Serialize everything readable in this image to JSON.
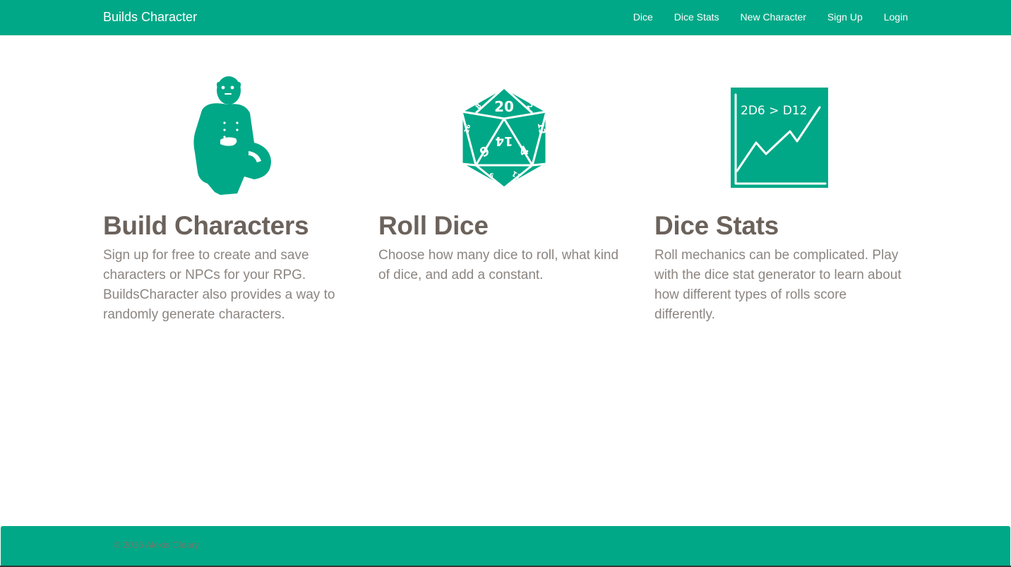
{
  "navbar": {
    "brand": "Builds Character",
    "links": [
      "Dice",
      "Dice Stats",
      "New Character",
      "Sign Up",
      "Login"
    ]
  },
  "features": [
    {
      "title": "Build Characters",
      "text": "Sign up for free to create and save characters or NPCs for your RPG. BuildsCharacter also provides a way to randomly generate characters.",
      "icon": "crouching-character-icon"
    },
    {
      "title": "Roll Dice",
      "text": "Choose how many dice to roll, what kind of dice, and add a constant.",
      "icon": "d20-icon",
      "die_faces": [
        "20",
        "14",
        "8",
        "2",
        "16",
        "13",
        "6",
        "4",
        "9",
        "11"
      ]
    },
    {
      "title": "Dice Stats",
      "text": "Roll mechanics can be complicated. Play with the dice stat generator to learn about how different types of rolls score differently.",
      "icon": "stats-chart-icon",
      "chart_caption": "2D6 > D12"
    }
  ],
  "footer": {
    "text": "© 2016 Alexis Cleary"
  },
  "colors": {
    "accent": "#00a887",
    "heading": "#6b625b",
    "body_text": "#8c8580"
  }
}
